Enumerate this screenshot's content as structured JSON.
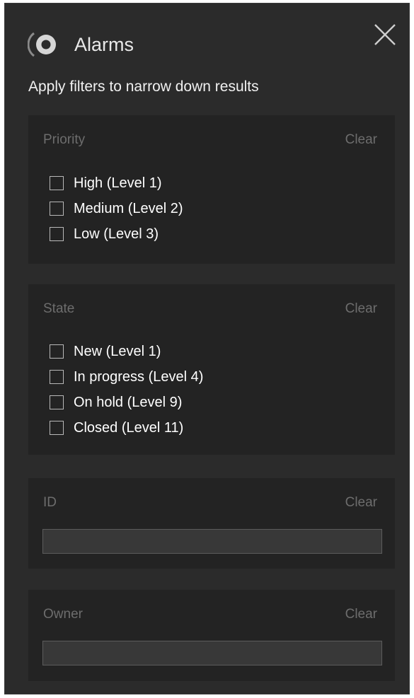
{
  "window": {
    "title": "Alarms",
    "subtitle": "Apply filters to narrow down results"
  },
  "filters": {
    "priority": {
      "label": "Priority",
      "clear": "Clear",
      "options": [
        {
          "label": "High (Level 1)",
          "checked": false
        },
        {
          "label": "Medium (Level 2)",
          "checked": false
        },
        {
          "label": "Low (Level 3)",
          "checked": false
        }
      ]
    },
    "state": {
      "label": "State",
      "clear": "Clear",
      "options": [
        {
          "label": "New (Level 1)",
          "checked": false
        },
        {
          "label": "In progress (Level 4)",
          "checked": false
        },
        {
          "label": "On hold (Level 9)",
          "checked": false
        },
        {
          "label": "Closed (Level 11)",
          "checked": false
        }
      ]
    },
    "id": {
      "label": "ID",
      "clear": "Clear",
      "value": ""
    },
    "owner": {
      "label": "Owner",
      "clear": "Clear",
      "value": ""
    }
  },
  "icons": {
    "app": "alarm-logo-icon",
    "close": "close-icon"
  },
  "colors": {
    "background": "#2b2b2b",
    "panel": "#232323",
    "muted_text": "#6d6d6d",
    "text": "#ffffff"
  }
}
